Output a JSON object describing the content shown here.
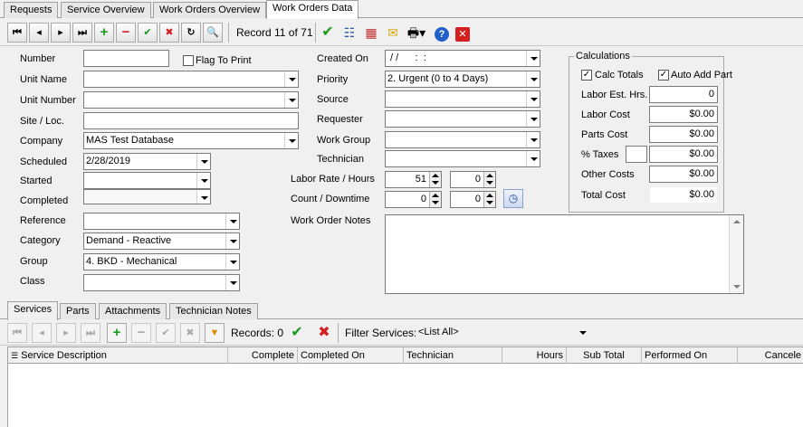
{
  "tabs": [
    "Requests",
    "Service Overview",
    "Work Orders Overview",
    "Work Orders Data"
  ],
  "toolbar": {
    "record": "Record 11 of 71"
  },
  "form": {
    "number": {
      "label": "Number",
      "value": ""
    },
    "flag_to_print": {
      "label": "Flag To Print",
      "checked": false
    },
    "unit_name": {
      "label": "Unit Name",
      "value": ""
    },
    "unit_number": {
      "label": "Unit Number",
      "value": ""
    },
    "site": {
      "label": "Site / Loc.",
      "value": ""
    },
    "company": {
      "label": "Company",
      "value": "MAS Test Database"
    },
    "scheduled": {
      "label": "Scheduled",
      "value": "2/28/2019"
    },
    "started": {
      "label": "Started",
      "value": ""
    },
    "completed": {
      "label": "Completed",
      "value": ""
    },
    "reference": {
      "label": "Reference",
      "value": ""
    },
    "category": {
      "label": "Category",
      "value": "Demand - Reactive"
    },
    "group": {
      "label": "Group",
      "value": "4. BKD - Mechanical"
    },
    "class": {
      "label": "Class",
      "value": ""
    },
    "created_on": {
      "label": "Created On",
      "value": " / /      :  :"
    },
    "priority": {
      "label": "Priority",
      "value": "2. Urgent (0 to 4 Days)"
    },
    "source": {
      "label": "Source",
      "value": ""
    },
    "requester": {
      "label": "Requester",
      "value": ""
    },
    "work_group": {
      "label": "Work Group",
      "value": ""
    },
    "technician": {
      "label": "Technician",
      "value": ""
    },
    "labor_rate": {
      "label": "Labor Rate / Hours",
      "rate": "51",
      "hours": "0"
    },
    "count": {
      "label": "Count / Downtime",
      "count": "0",
      "downtime": "0"
    },
    "notes": {
      "label": "Work Order Notes",
      "value": ""
    }
  },
  "calculations": {
    "title": "Calculations",
    "calc_totals": {
      "label": "Calc Totals",
      "checked": true
    },
    "auto_add_part": {
      "label": "Auto Add Part",
      "checked": true
    },
    "labor_est_hrs": {
      "label": "Labor Est. Hrs.",
      "value": "0"
    },
    "labor_cost": {
      "label": "Labor Cost",
      "value": "$0.00"
    },
    "parts_cost": {
      "label": "Parts Cost",
      "value": "$0.00"
    },
    "taxes": {
      "label": "% Taxes",
      "percent": "",
      "value": "$0.00"
    },
    "other_costs": {
      "label": "Other Costs",
      "value": "$0.00"
    },
    "total_cost": {
      "label": "Total Cost",
      "value": "$0.00"
    }
  },
  "bottom_tabs": [
    "Services",
    "Parts",
    "Attachments",
    "Technician Notes"
  ],
  "services_toolbar": {
    "records": "Records: 0",
    "filter_label": "Filter Services:",
    "filter_value": "<List All>"
  },
  "grid": {
    "columns": [
      "Service Description",
      "Complete",
      "Completed On",
      "Technician",
      "Hours",
      "Sub Total",
      "Performed On",
      "Cancele"
    ]
  },
  "colors": {
    "accent_green": "#1a9a1a",
    "accent_red": "#d42020"
  }
}
